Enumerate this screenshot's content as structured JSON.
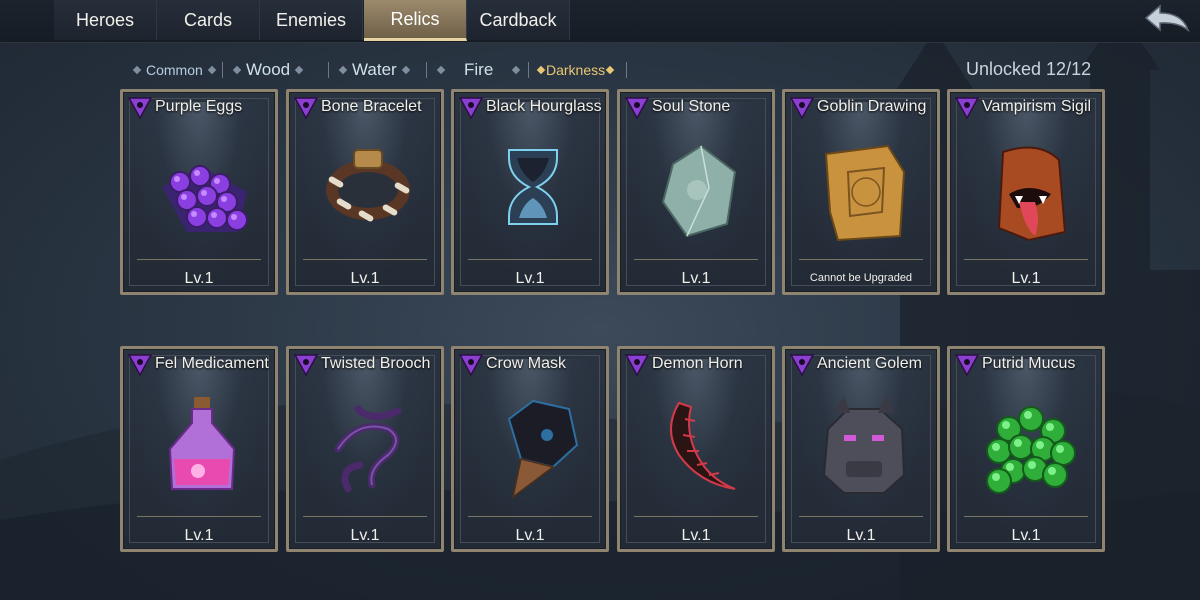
{
  "tabs": [
    {
      "label": "Heroes",
      "active": false
    },
    {
      "label": "Cards",
      "active": false
    },
    {
      "label": "Enemies",
      "active": false
    },
    {
      "label": "Relics",
      "active": true
    },
    {
      "label": "Cardback",
      "active": false
    }
  ],
  "filters": {
    "common": "Common",
    "wood": "Wood",
    "water": "Water",
    "fire": "Fire",
    "darkness": "Darkness",
    "selected": "Darkness"
  },
  "unlocked": "Unlocked 12/12",
  "cards": [
    {
      "name": "Purple Eggs",
      "level": "Lv.1",
      "icon": "purple-eggs-icon"
    },
    {
      "name": "Bone Bracelet",
      "level": "Lv.1",
      "icon": "bone-bracelet-icon"
    },
    {
      "name": "Black Hourglass",
      "level": "Lv.1",
      "icon": "hourglass-icon"
    },
    {
      "name": "Soul Stone",
      "level": "Lv.1",
      "icon": "soul-stone-icon"
    },
    {
      "name": "Goblin Drawing",
      "level": "Cannot be Upgraded",
      "icon": "goblin-drawing-icon"
    },
    {
      "name": "Vampirism Sigil",
      "level": "Lv.1",
      "icon": "vampirism-sigil-icon"
    },
    {
      "name": "Fel Medicament",
      "level": "Lv.1",
      "icon": "potion-icon"
    },
    {
      "name": "Twisted Brooch",
      "level": "Lv.1",
      "icon": "twisted-brooch-icon"
    },
    {
      "name": "Crow Mask",
      "level": "Lv.1",
      "icon": "crow-mask-icon"
    },
    {
      "name": "Demon Horn",
      "level": "Lv.1",
      "icon": "demon-horn-icon"
    },
    {
      "name": "Ancient Golem",
      "level": "Lv.1",
      "icon": "golem-head-icon"
    },
    {
      "name": "Putrid Mucus",
      "level": "Lv.1",
      "icon": "putrid-mucus-icon"
    }
  ],
  "colors": {
    "accent": "#e8c675",
    "card_border": "#8e8470",
    "emblem": "#8a3fd0"
  }
}
